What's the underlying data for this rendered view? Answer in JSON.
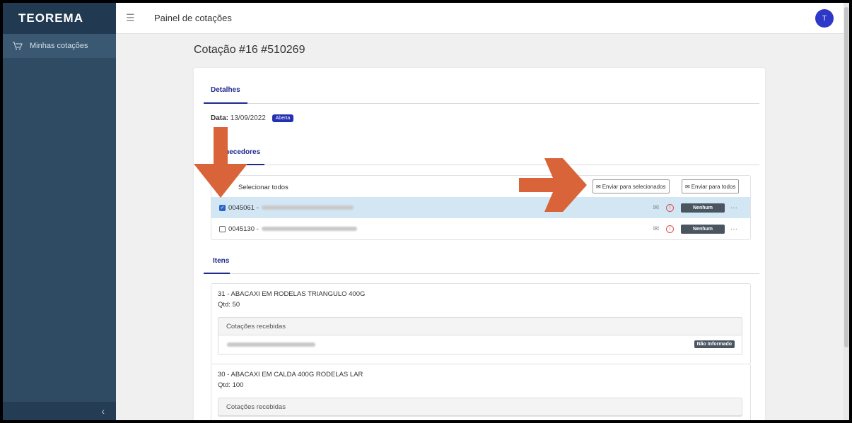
{
  "app": {
    "logo_text": "TEOREMA"
  },
  "sidebar": {
    "items": [
      {
        "label": "Minhas cotações",
        "icon": "cart-icon"
      }
    ],
    "collapse_label": "‹"
  },
  "topbar": {
    "title": "Painel de cotações",
    "avatar_initial": "T"
  },
  "page": {
    "title": "Cotação  #16 #510269"
  },
  "details": {
    "tab_label": "Detalhes",
    "date_label": "Data:",
    "date_value": "13/09/2022",
    "status_badge": "Aberta"
  },
  "suppliers": {
    "tab_label": "Fornecedores",
    "select_all_label": "Selecionar todos",
    "send_selected_label": "Enviar para selecionados",
    "send_all_label": "Enviar para todos",
    "rows": [
      {
        "code": "0045061 -",
        "checked": true,
        "status": "Nenhum"
      },
      {
        "code": "0045130 -",
        "checked": false,
        "status": "Nenhum"
      }
    ]
  },
  "items": {
    "tab_label": "Itens",
    "list": [
      {
        "title": "31 - ABACAXI EM RODELAS TRIANGULO 400G",
        "qtd": "Qtd: 50",
        "received_label": "Cotações recebidas",
        "received_status": "Não Informado"
      },
      {
        "title": "30 - ABACAXI EM CALDA 400G RODELAS LAR",
        "qtd": "Qtd: 100",
        "received_label": "Cotações recebidas"
      }
    ]
  },
  "colors": {
    "accent": "#1f2a8c",
    "sidebar": "#2f4a63",
    "selected_row": "#d3e6f4",
    "arrow": "#d9643a"
  }
}
